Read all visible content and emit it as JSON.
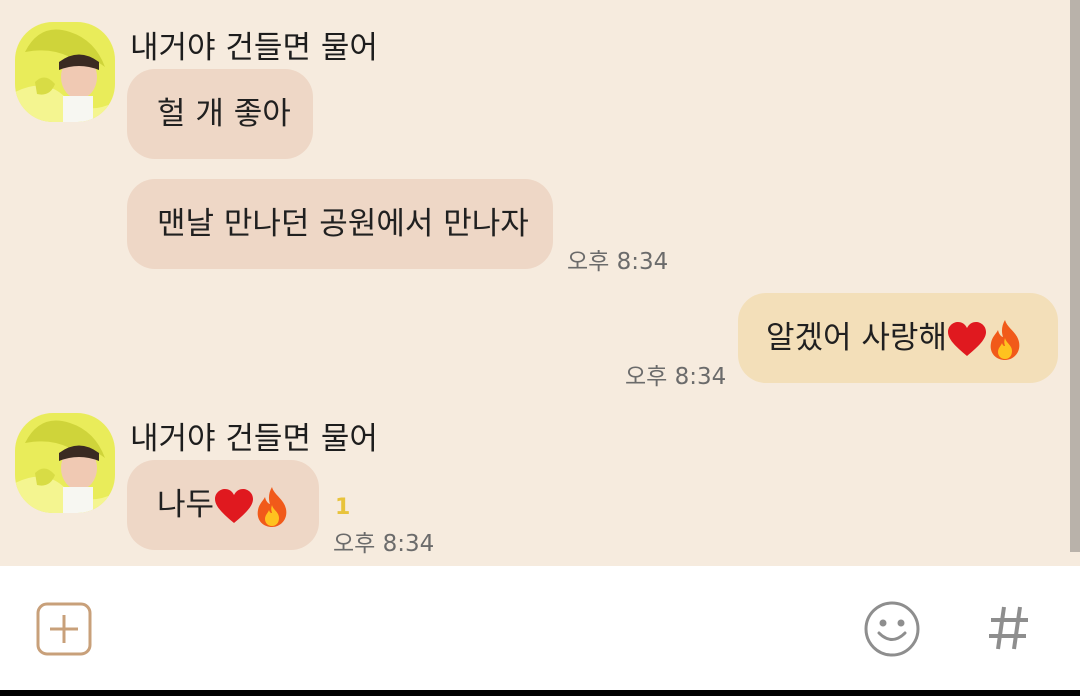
{
  "messages": [
    {
      "sender": "내거야 건들면 물어",
      "lines": [
        "헐 개 좋아",
        "맨날 만나던 공원에서 만나자"
      ],
      "time": "오후 8:34"
    },
    {
      "mine": true,
      "text": "알겠어 사랑해",
      "time": "오후 8:34"
    },
    {
      "sender": "내거야 건들면 물어",
      "text": "나두",
      "unread": "1",
      "time": "오후 8:34"
    }
  ],
  "input_bar": {
    "icons": [
      "plus-icon",
      "emoji-icon",
      "hashtag-icon"
    ]
  },
  "colors": {
    "chat_background": "#f6ebde",
    "incoming_bubble": "#eed7c6",
    "outgoing_bubble": "#f3dfb9",
    "unread_count": "#e8c33b",
    "input_icon": "#c8a07a"
  }
}
